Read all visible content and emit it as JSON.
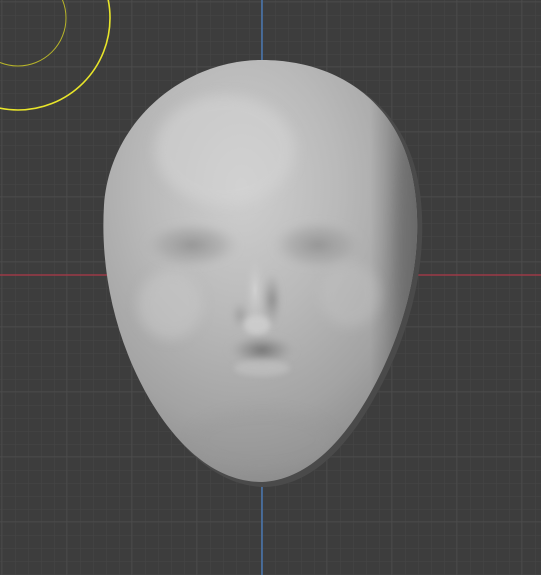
{
  "viewport": {
    "mode": "3d-viewport",
    "view": "front-orthographic",
    "background_color": "#3d3d3d",
    "grid_minor_color": "#474747",
    "grid_major_color": "#525252",
    "x_axis_color": "#9b3a47",
    "z_axis_color": "#4877b1",
    "gizmo_color": "#e8e52a"
  },
  "scene_object": {
    "kind": "sculpted-face-mesh",
    "surface_color": "#b8b8b8",
    "shadow_color": "#5b5b5b"
  }
}
